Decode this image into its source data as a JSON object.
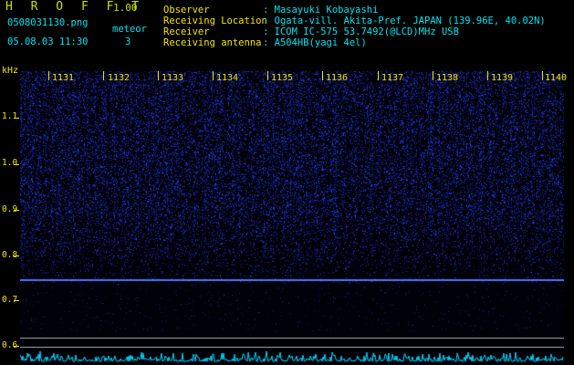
{
  "header": {
    "app_title": "H R O F F T",
    "app_version": "1.00",
    "file_name": "0508031130.png",
    "mode": "meteor",
    "datetime": "05.08.03 11:30",
    "meteor_count": "3",
    "fields": [
      {
        "label": "Observer",
        "value": ": Masayuki Kobayashi"
      },
      {
        "label": "Receiving Location",
        "value": ": Ogata-vill. Akita-Pref. JAPAN (139.96E, 40.02N)"
      },
      {
        "label": "Receiver",
        "value": ": ICOM IC-575 53.7492(@LCD)MHz USB"
      },
      {
        "label": "Receiving antenna",
        "value": ": A504HB(yagi 4el)"
      }
    ]
  },
  "axis": {
    "unit": "kHz",
    "y_labels": [
      "1.1",
      "1.0",
      "0.9",
      "0.8",
      "0.7",
      "0.6"
    ],
    "x_labels": [
      "1131",
      "1132",
      "1133",
      "1134",
      "1135",
      "1136",
      "1137",
      "1138",
      "1139",
      "1140"
    ]
  },
  "colors": {
    "background": "#000000",
    "text_yellow": "#f2e600",
    "text_cyan": "#00e4f0",
    "spectrum_blue": "#2a3cff",
    "carrier_line": "#4a78ff",
    "level_trace": "#00d8ff"
  }
}
